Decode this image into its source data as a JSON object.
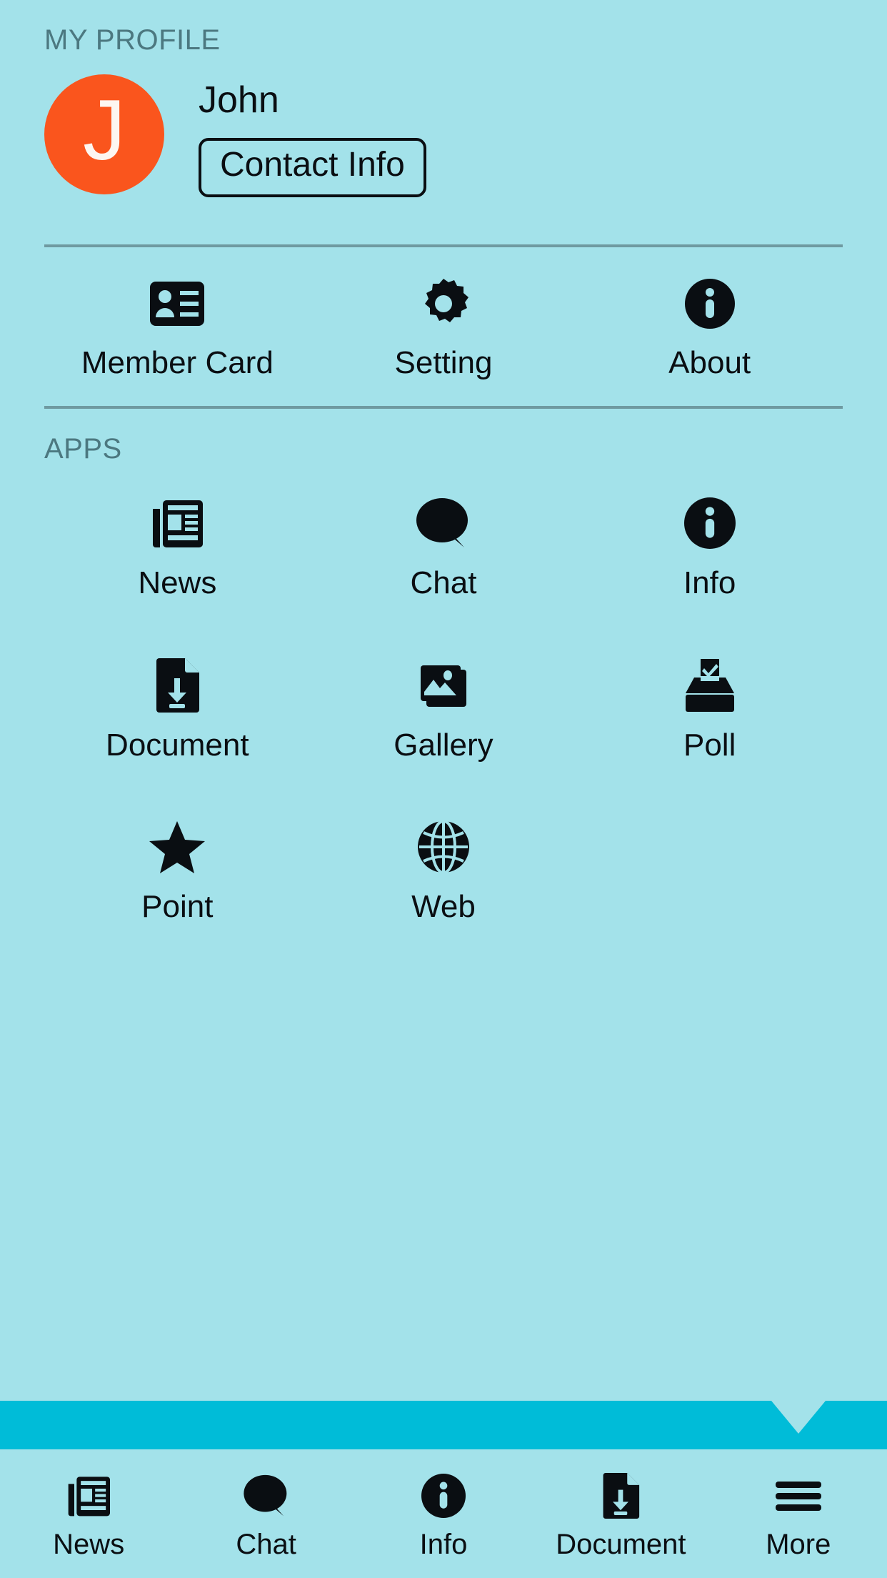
{
  "theme": {
    "background": "#a3e2ea",
    "accent_bar": "#00bcd8",
    "avatar_bg": "#fa551d",
    "avatar_fg": "#fdf6f1",
    "section_header_color": "#4c7880",
    "divider_color": "#6f9aa1",
    "text_color": "#0a0e12"
  },
  "profile_section": {
    "header": "MY PROFILE",
    "avatar_initial": "J",
    "name": "John",
    "contact_button_label": "Contact Info"
  },
  "quick_actions": [
    {
      "label": "Member Card",
      "icon": "member-card-icon"
    },
    {
      "label": "Setting",
      "icon": "gear-icon"
    },
    {
      "label": "About",
      "icon": "info-circle-icon"
    }
  ],
  "apps_section": {
    "header": "APPS",
    "items": [
      {
        "label": "News",
        "icon": "newspaper-icon"
      },
      {
        "label": "Chat",
        "icon": "speech-bubble-icon"
      },
      {
        "label": "Info",
        "icon": "info-circle-icon"
      },
      {
        "label": "Document",
        "icon": "file-download-icon"
      },
      {
        "label": "Gallery",
        "icon": "photos-icon"
      },
      {
        "label": "Poll",
        "icon": "ballot-box-icon"
      },
      {
        "label": "Point",
        "icon": "star-icon"
      },
      {
        "label": "Web",
        "icon": "globe-icon"
      }
    ]
  },
  "bottom_nav": {
    "active_index": 4,
    "items": [
      {
        "label": "News",
        "icon": "newspaper-icon"
      },
      {
        "label": "Chat",
        "icon": "speech-bubble-icon"
      },
      {
        "label": "Info",
        "icon": "info-circle-icon"
      },
      {
        "label": "Document",
        "icon": "file-download-icon"
      },
      {
        "label": "More",
        "icon": "hamburger-menu-icon"
      }
    ]
  }
}
